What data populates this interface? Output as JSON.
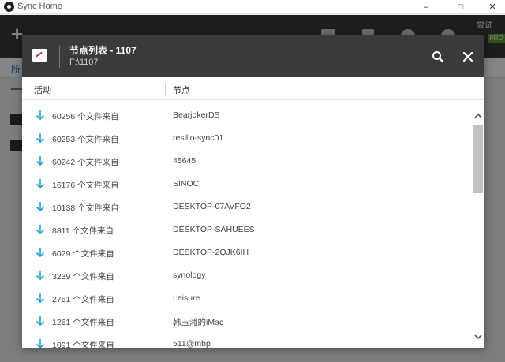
{
  "window": {
    "title": "Sync Home",
    "trial_label": "尝试",
    "badge_label": "PRO",
    "background_tab": "所"
  },
  "dialog": {
    "title": "节点列表 - 1107",
    "subtitle": "F:\\1107",
    "search_icon": "search-icon",
    "close_icon": "close-icon",
    "columns": {
      "activity": "活动",
      "peer": "节点"
    },
    "rows": [
      {
        "activity": "60256 个文件来自",
        "peer": "BearjokerDS"
      },
      {
        "activity": "60253 个文件来自",
        "peer": "resilio-sync01"
      },
      {
        "activity": "60242 个文件来自",
        "peer": "45645"
      },
      {
        "activity": "16176 个文件来自",
        "peer": "SINOC"
      },
      {
        "activity": "10138 个文件来自",
        "peer": "DESKTOP-07AVFO2"
      },
      {
        "activity": "8811 个文件来自",
        "peer": "DESKTOP-SAHUEES"
      },
      {
        "activity": "6029 个文件来自",
        "peer": "DESKTOP-2QJK6IH"
      },
      {
        "activity": "3239 个文件来自",
        "peer": "synology"
      },
      {
        "activity": "2751 个文件来自",
        "peer": "Leisure"
      },
      {
        "activity": "1261 个文件来自",
        "peer": "韩玉湘的iMac"
      },
      {
        "activity": "1091 个文件来自",
        "peer": "511@mbp"
      }
    ]
  },
  "colors": {
    "accent_arrow": "#1ba1e2",
    "header_bg": "#3a3a3a",
    "toolbar_bg": "#3b3b3b"
  }
}
